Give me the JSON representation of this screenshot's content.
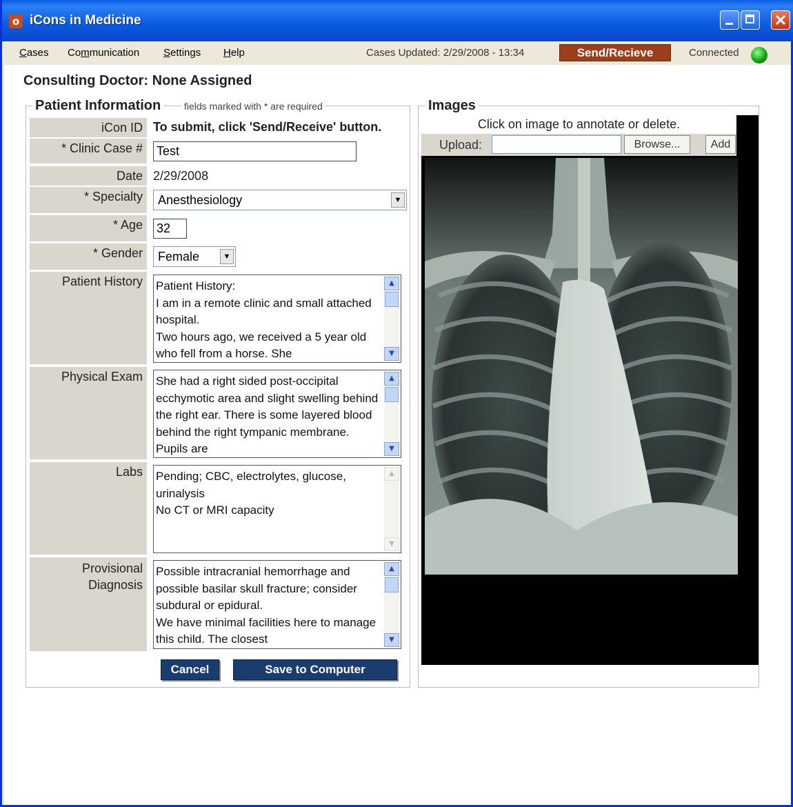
{
  "window": {
    "title": "iCons in Medicine",
    "icon_glyph": "o"
  },
  "menu": {
    "cases": {
      "accel": "C",
      "rest": "ases"
    },
    "communication": {
      "pre": "Co",
      "accel": "m",
      "rest": "munication"
    },
    "settings": {
      "accel": "S",
      "rest": "ettings"
    },
    "help": {
      "accel": "H",
      "rest": "elp"
    }
  },
  "status": {
    "cases_updated": "Cases Updated: 2/29/2008 - 13:34",
    "send_receive": "Send/Recieve",
    "connection": "Connected",
    "connection_color": "#16a316"
  },
  "consulting_doctor": "Consulting Doctor: None Assigned",
  "patient_info": {
    "legend": "Patient Information",
    "note": "fields marked with * are required",
    "icon_id": {
      "label": "iCon ID",
      "value": "To submit, click 'Send/Receive' button."
    },
    "clinic_case": {
      "label": "* Clinic Case #",
      "value": "Test"
    },
    "date": {
      "label": "Date",
      "value": "2/29/2008"
    },
    "specialty": {
      "label": "* Specialty",
      "value": "Anesthesiology"
    },
    "age": {
      "label": "* Age",
      "value": "32"
    },
    "gender": {
      "label": "* Gender",
      "value": "Female"
    },
    "patient_history": {
      "label": "Patient History",
      "value": "Patient History:\nI am in a remote clinic and small attached hospital.\nTwo hours ago, we received a 5 year old who fell from a horse. She"
    },
    "physical_exam": {
      "label": "Physical Exam",
      "value": "She had a right sided post-occipital ecchymotic area and slight swelling behind the right ear. There is some layered blood behind the right tympanic membrane. Pupils are"
    },
    "labs": {
      "label": "Labs",
      "value": "Pending; CBC, electrolytes, glucose, urinalysis\nNo CT or MRI capacity"
    },
    "provisional_diagnosis": {
      "label_line1": "Provisional",
      "label_line2": "Diagnosis",
      "value": "Possible intracranial hemorrhage and possible basilar skull fracture; consider subdural or epidural.\nWe have minimal facilities here to manage this child. The closest"
    }
  },
  "buttons": {
    "cancel": "Cancel",
    "save": "Save to Computer"
  },
  "images": {
    "legend": "Images",
    "caption": "Click on image to annotate or delete.",
    "upload_label": "Upload:",
    "browse": "Browse...",
    "add": "Add"
  }
}
